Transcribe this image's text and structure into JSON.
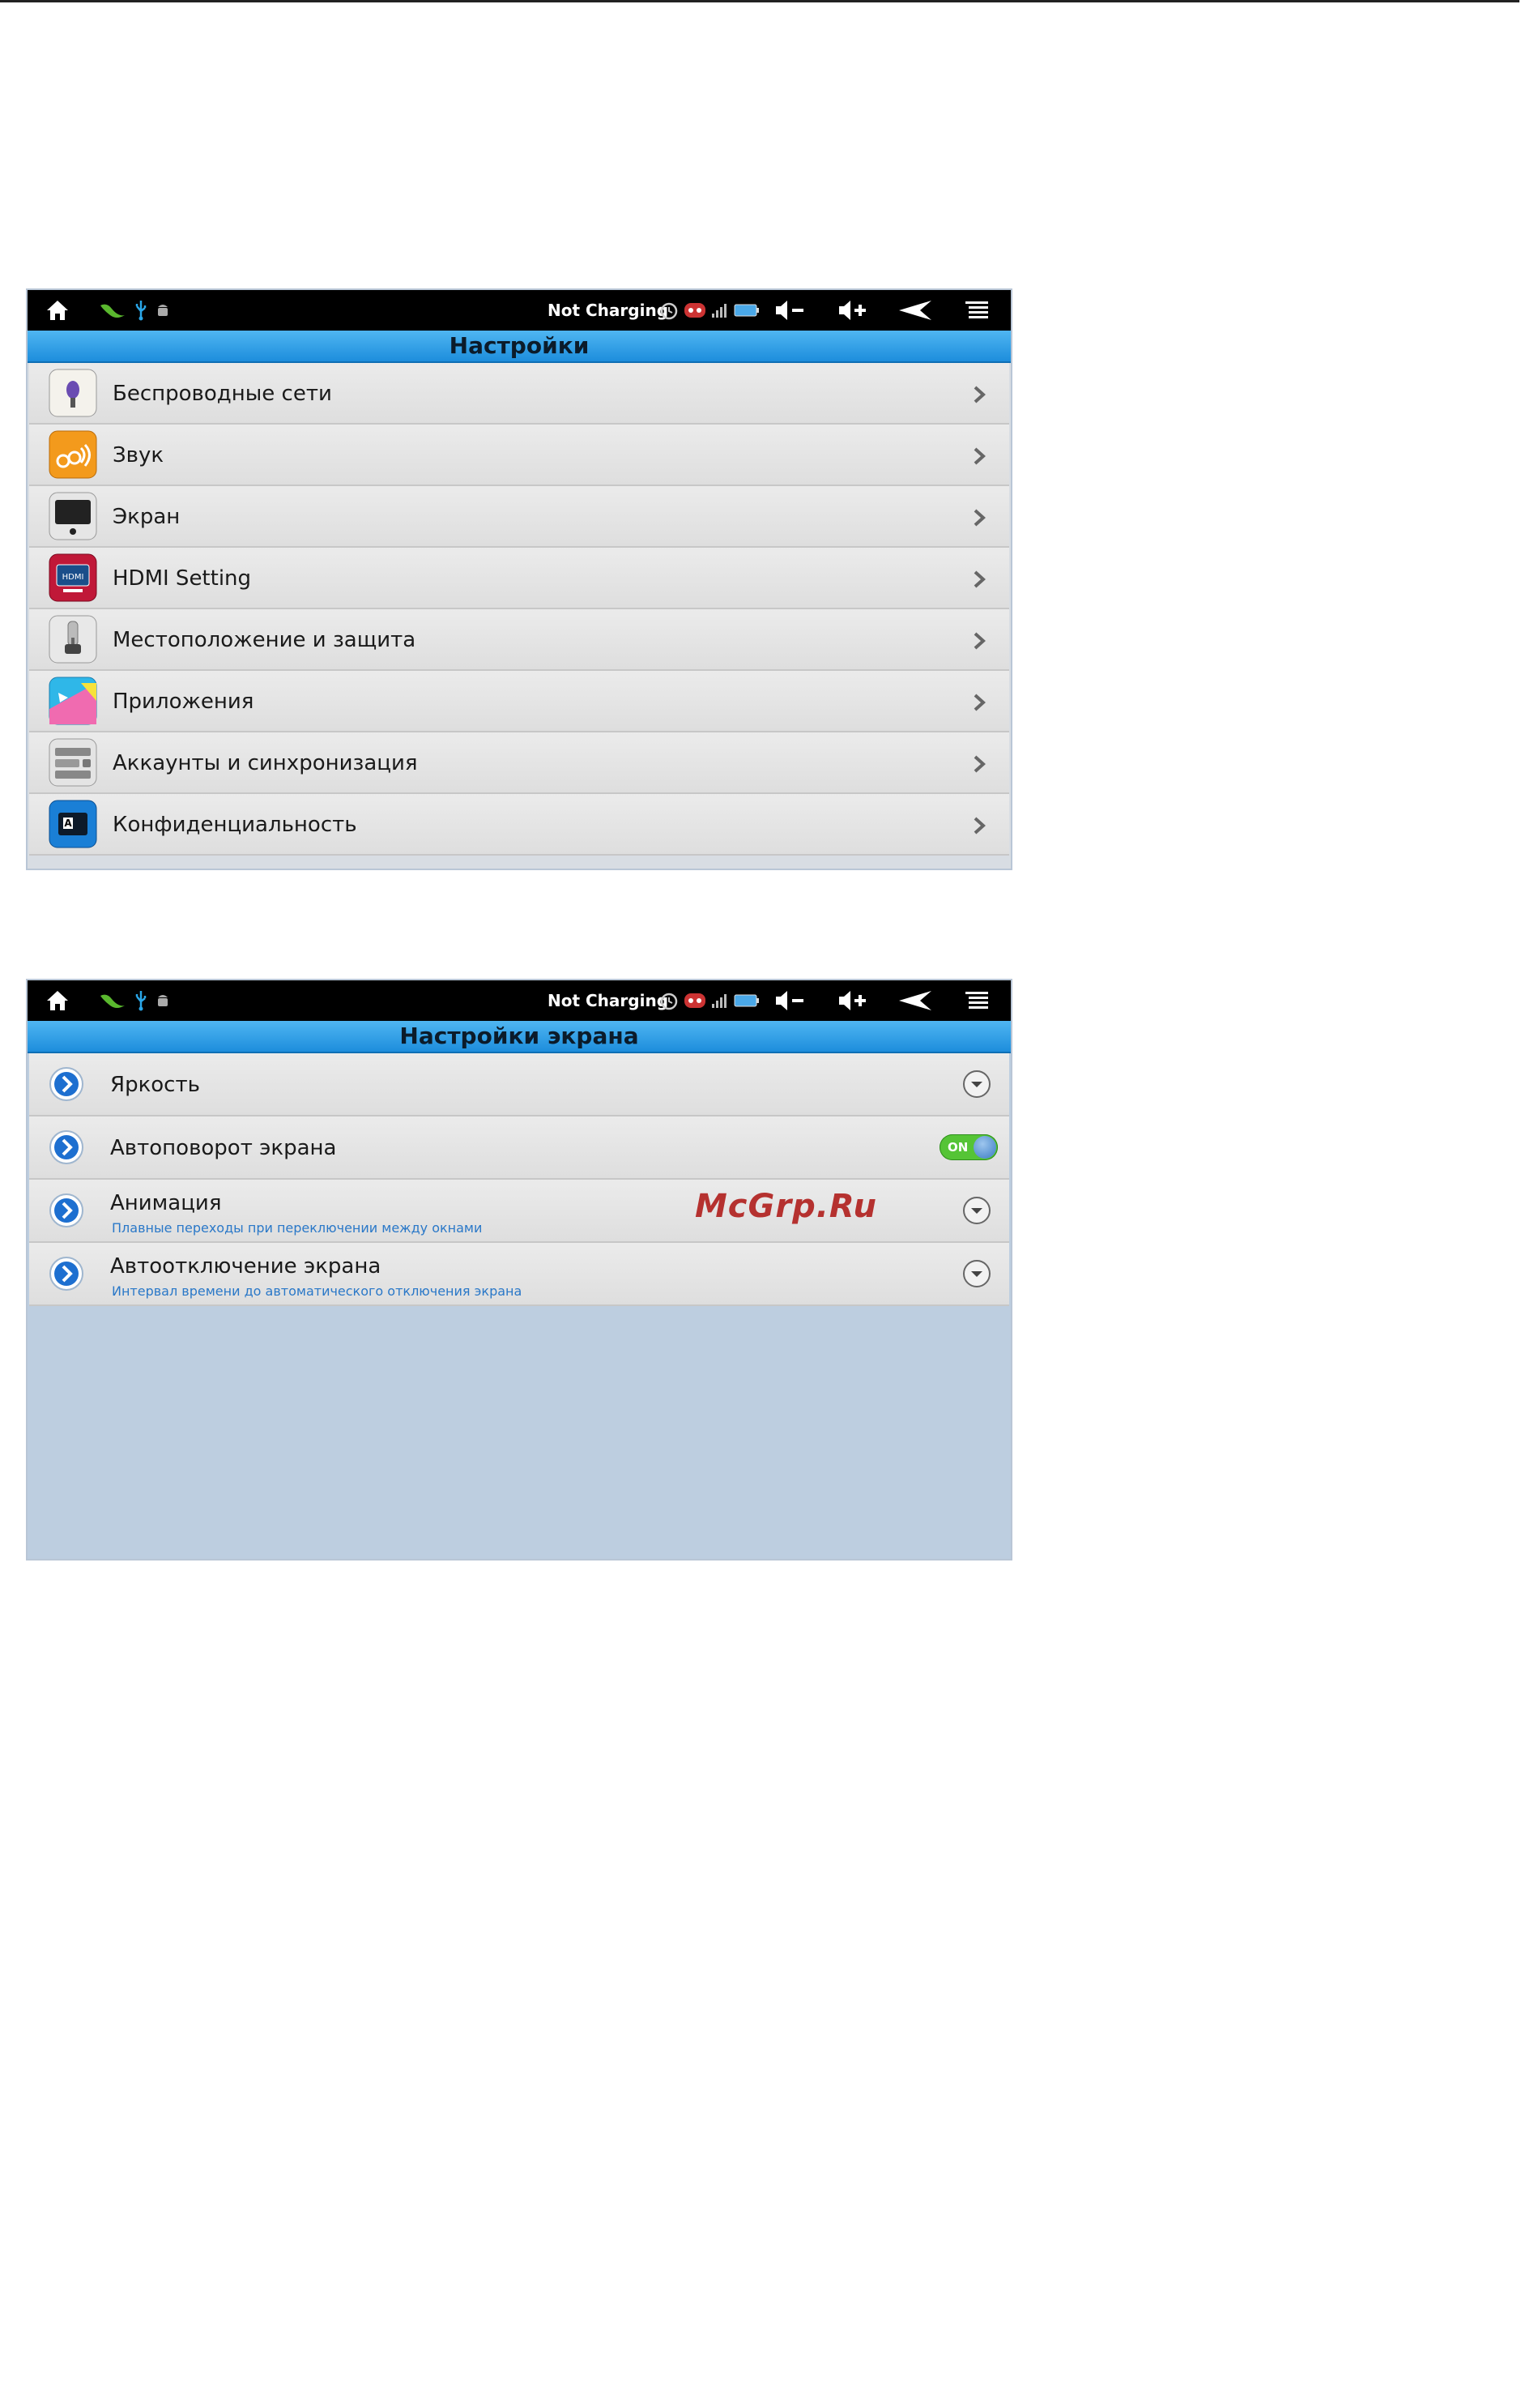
{
  "screen1": {
    "statusbar": {
      "status_text": "Not Charging"
    },
    "title": "Настройки",
    "items": [
      {
        "label": "Беспроводные сети",
        "icon": "wireless-icon"
      },
      {
        "label": "Звук",
        "icon": "sound-icon"
      },
      {
        "label": "Экран",
        "icon": "display-icon"
      },
      {
        "label": "HDMI Setting",
        "icon": "hdmi-icon",
        "icon_text": "HDMI"
      },
      {
        "label": "Местоположение и защита",
        "icon": "location-security-icon"
      },
      {
        "label": "Приложения",
        "icon": "applications-icon"
      },
      {
        "label": "Аккаунты и синхронизация",
        "icon": "accounts-sync-icon"
      },
      {
        "label": "Конфиденциальность",
        "icon": "privacy-icon",
        "icon_text": "A"
      }
    ]
  },
  "screen2": {
    "statusbar": {
      "status_text": "Not Charging"
    },
    "title": "Настройки экрана",
    "items": [
      {
        "label": "Яркость",
        "control": "expand"
      },
      {
        "label": "Автоповорот экрана",
        "control": "toggle",
        "toggle_text": "ON",
        "checked": true
      },
      {
        "label": "Анимация",
        "sublabel": "Плавные переходы при переключении между окнами",
        "control": "expand"
      },
      {
        "label": "Автоотключение экрана",
        "sublabel": "Интервал времени до автоматического отключения экрана",
        "control": "expand"
      }
    ]
  },
  "watermark": "McGrp.Ru",
  "colors": {
    "titlebar": "#1d8ddc",
    "toggle_on": "#55c436",
    "sublabel": "#2a78c8",
    "watermark": "#b5312f"
  }
}
